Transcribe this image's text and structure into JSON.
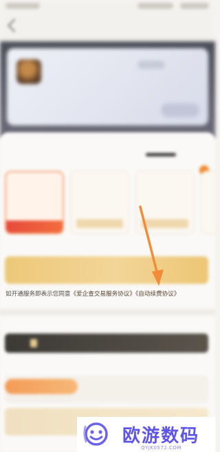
{
  "colors": {
    "accent_orange": "#f08a30",
    "cta_gold": "#f3d598",
    "watermark_purple": "#5f55e6",
    "arrow_orange": "#f28b3a"
  },
  "agreement": {
    "prefix": "如开通服务即表示您同意",
    "link1": "《爱企查交易服务协议》",
    "link2": "《自动续费协议》"
  },
  "watermark": {
    "title": "欧游数码",
    "url": "QYJK0572.COM",
    "icon": "smiley-logo-icon"
  },
  "arrow": {
    "icon": "arrow-down-icon"
  }
}
